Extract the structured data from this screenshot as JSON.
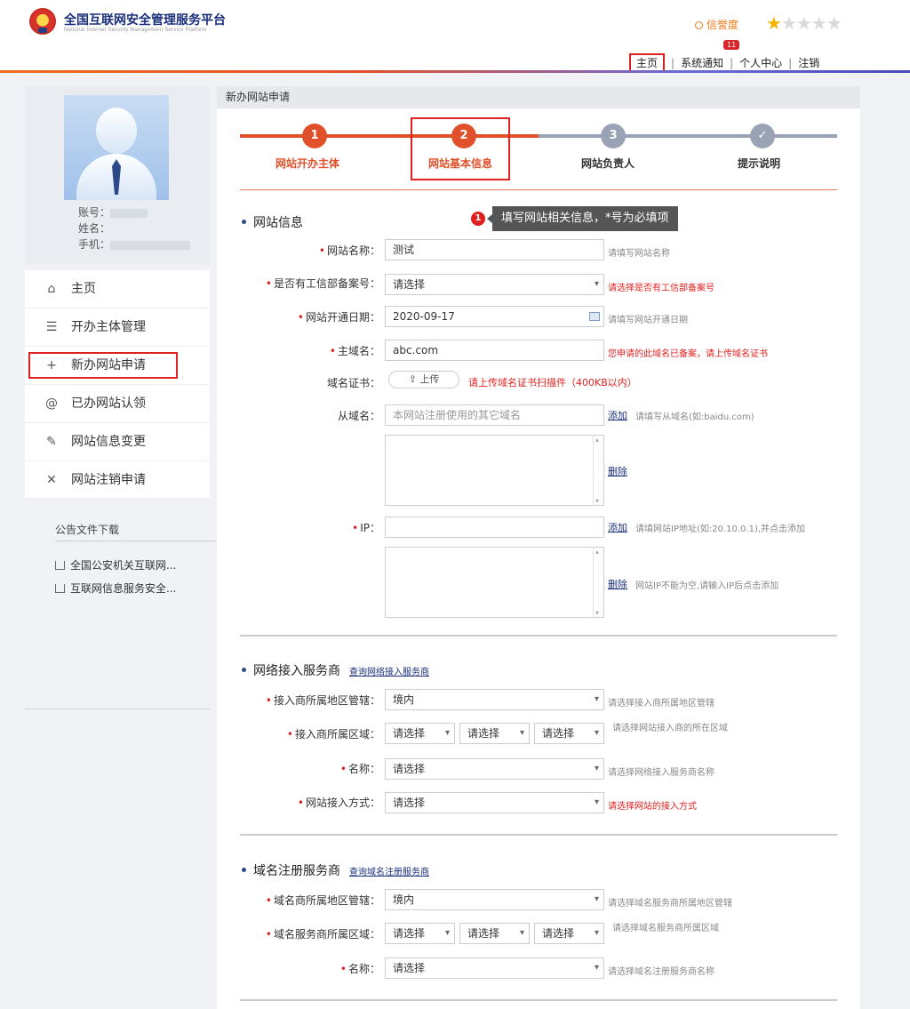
{
  "header": {
    "title": "全国互联网安全管理服务平台",
    "subtitle": "National Internet Security Management Service Platform",
    "credit_label": "信誉度",
    "stars_filled": 1,
    "stars_total": 5,
    "nav": {
      "home": "主页",
      "notify": "系统通知",
      "notify_badge": "11",
      "profile": "个人中心",
      "logout": "注销"
    },
    "accent": "#e0502a"
  },
  "sidebar": {
    "account_label": "账号：",
    "name_label": "姓名：",
    "phone_label": "手机：",
    "menu": [
      {
        "label": "主页",
        "icon": "home-icon"
      },
      {
        "label": "开办主体管理",
        "icon": "list-icon"
      },
      {
        "label": "新办网站申请",
        "icon": "plus-icon"
      },
      {
        "label": "已办网站认领",
        "icon": "at-icon"
      },
      {
        "label": "网站信息变更",
        "icon": "edit-icon"
      },
      {
        "label": "网站注销申请",
        "icon": "close-icon"
      }
    ],
    "downloads_title": "公告文件下载",
    "downloads": [
      "全国公安机关互联网...",
      "互联网信息服务安全..."
    ]
  },
  "main": {
    "page_title": "新办网站申请",
    "steps": [
      {
        "num": "1",
        "label": "网站开办主体"
      },
      {
        "num": "2",
        "label": "网站基本信息"
      },
      {
        "num": "3",
        "label": "网站负责人"
      },
      {
        "num": "✓",
        "label": "提示说明"
      }
    ],
    "tip_num": "1",
    "tip_text": "填写网站相关信息，*号为必填项",
    "site_info": {
      "title": "网站信息",
      "name_label": "网站名称：",
      "name_value": "测试",
      "name_hint": "请填写网站名称",
      "icp_label": "是否有工信部备案号：",
      "icp_value": "请选择",
      "icp_hint": "请选择是否有工信部备案号",
      "date_label": "网站开通日期：",
      "date_value": "2020-09-17",
      "date_hint": "请填写网站开通日期",
      "domain_label": "主域名：",
      "domain_value": "abc.com",
      "domain_hint": "您申请的此域名已备案，请上传域名证书",
      "cert_label": "域名证书：",
      "cert_button": "上传",
      "cert_hint": "请上传域名证书扫描件（400KB以内）",
      "subdomain_label": "从域名：",
      "subdomain_placeholder": "本网站注册使用的其它域名",
      "subdomain_add": "添加",
      "subdomain_hint": "请填写从域名(如:baidu.com)",
      "subdomain_delete": "删除",
      "ip_label": "IP：",
      "ip_add": "添加",
      "ip_hint": "请填网站IP地址(如:20.10.0.1),并点击添加",
      "ip_delete": "删除",
      "ip_delete_hint": "网站IP不能为空,请输入IP后点击添加"
    },
    "access": {
      "title": "网络接入服务商",
      "link": "查询网络接入服务商",
      "region_label": "接入商所属地区管辖：",
      "region_value": "境内",
      "region_hint": "请选择接入商所属地区管辖",
      "area_label": "接入商所属区域：",
      "area_values": [
        "请选择",
        "请选择",
        "请选择"
      ],
      "area_hint": "请选择网站接入商的所在区域",
      "name_label": "名称：",
      "name_value": "请选择",
      "name_hint": "请选择网络接入服务商名称",
      "mode_label": "网站接入方式：",
      "mode_value": "请选择",
      "mode_hint": "请选择网站的接入方式"
    },
    "registrar": {
      "title": "域名注册服务商",
      "link": "查询域名注册服务商",
      "region_label": "域名商所属地区管辖：",
      "region_value": "境内",
      "region_hint": "请选择域名服务商所属地区管辖",
      "area_label": "域名服务商所属区域：",
      "area_values": [
        "请选择",
        "请选择",
        "请选择"
      ],
      "area_hint": "请选择域名服务商所属区域",
      "name_label": "名称：",
      "name_value": "请选择",
      "name_hint": "请选择域名注册服务商名称"
    }
  }
}
